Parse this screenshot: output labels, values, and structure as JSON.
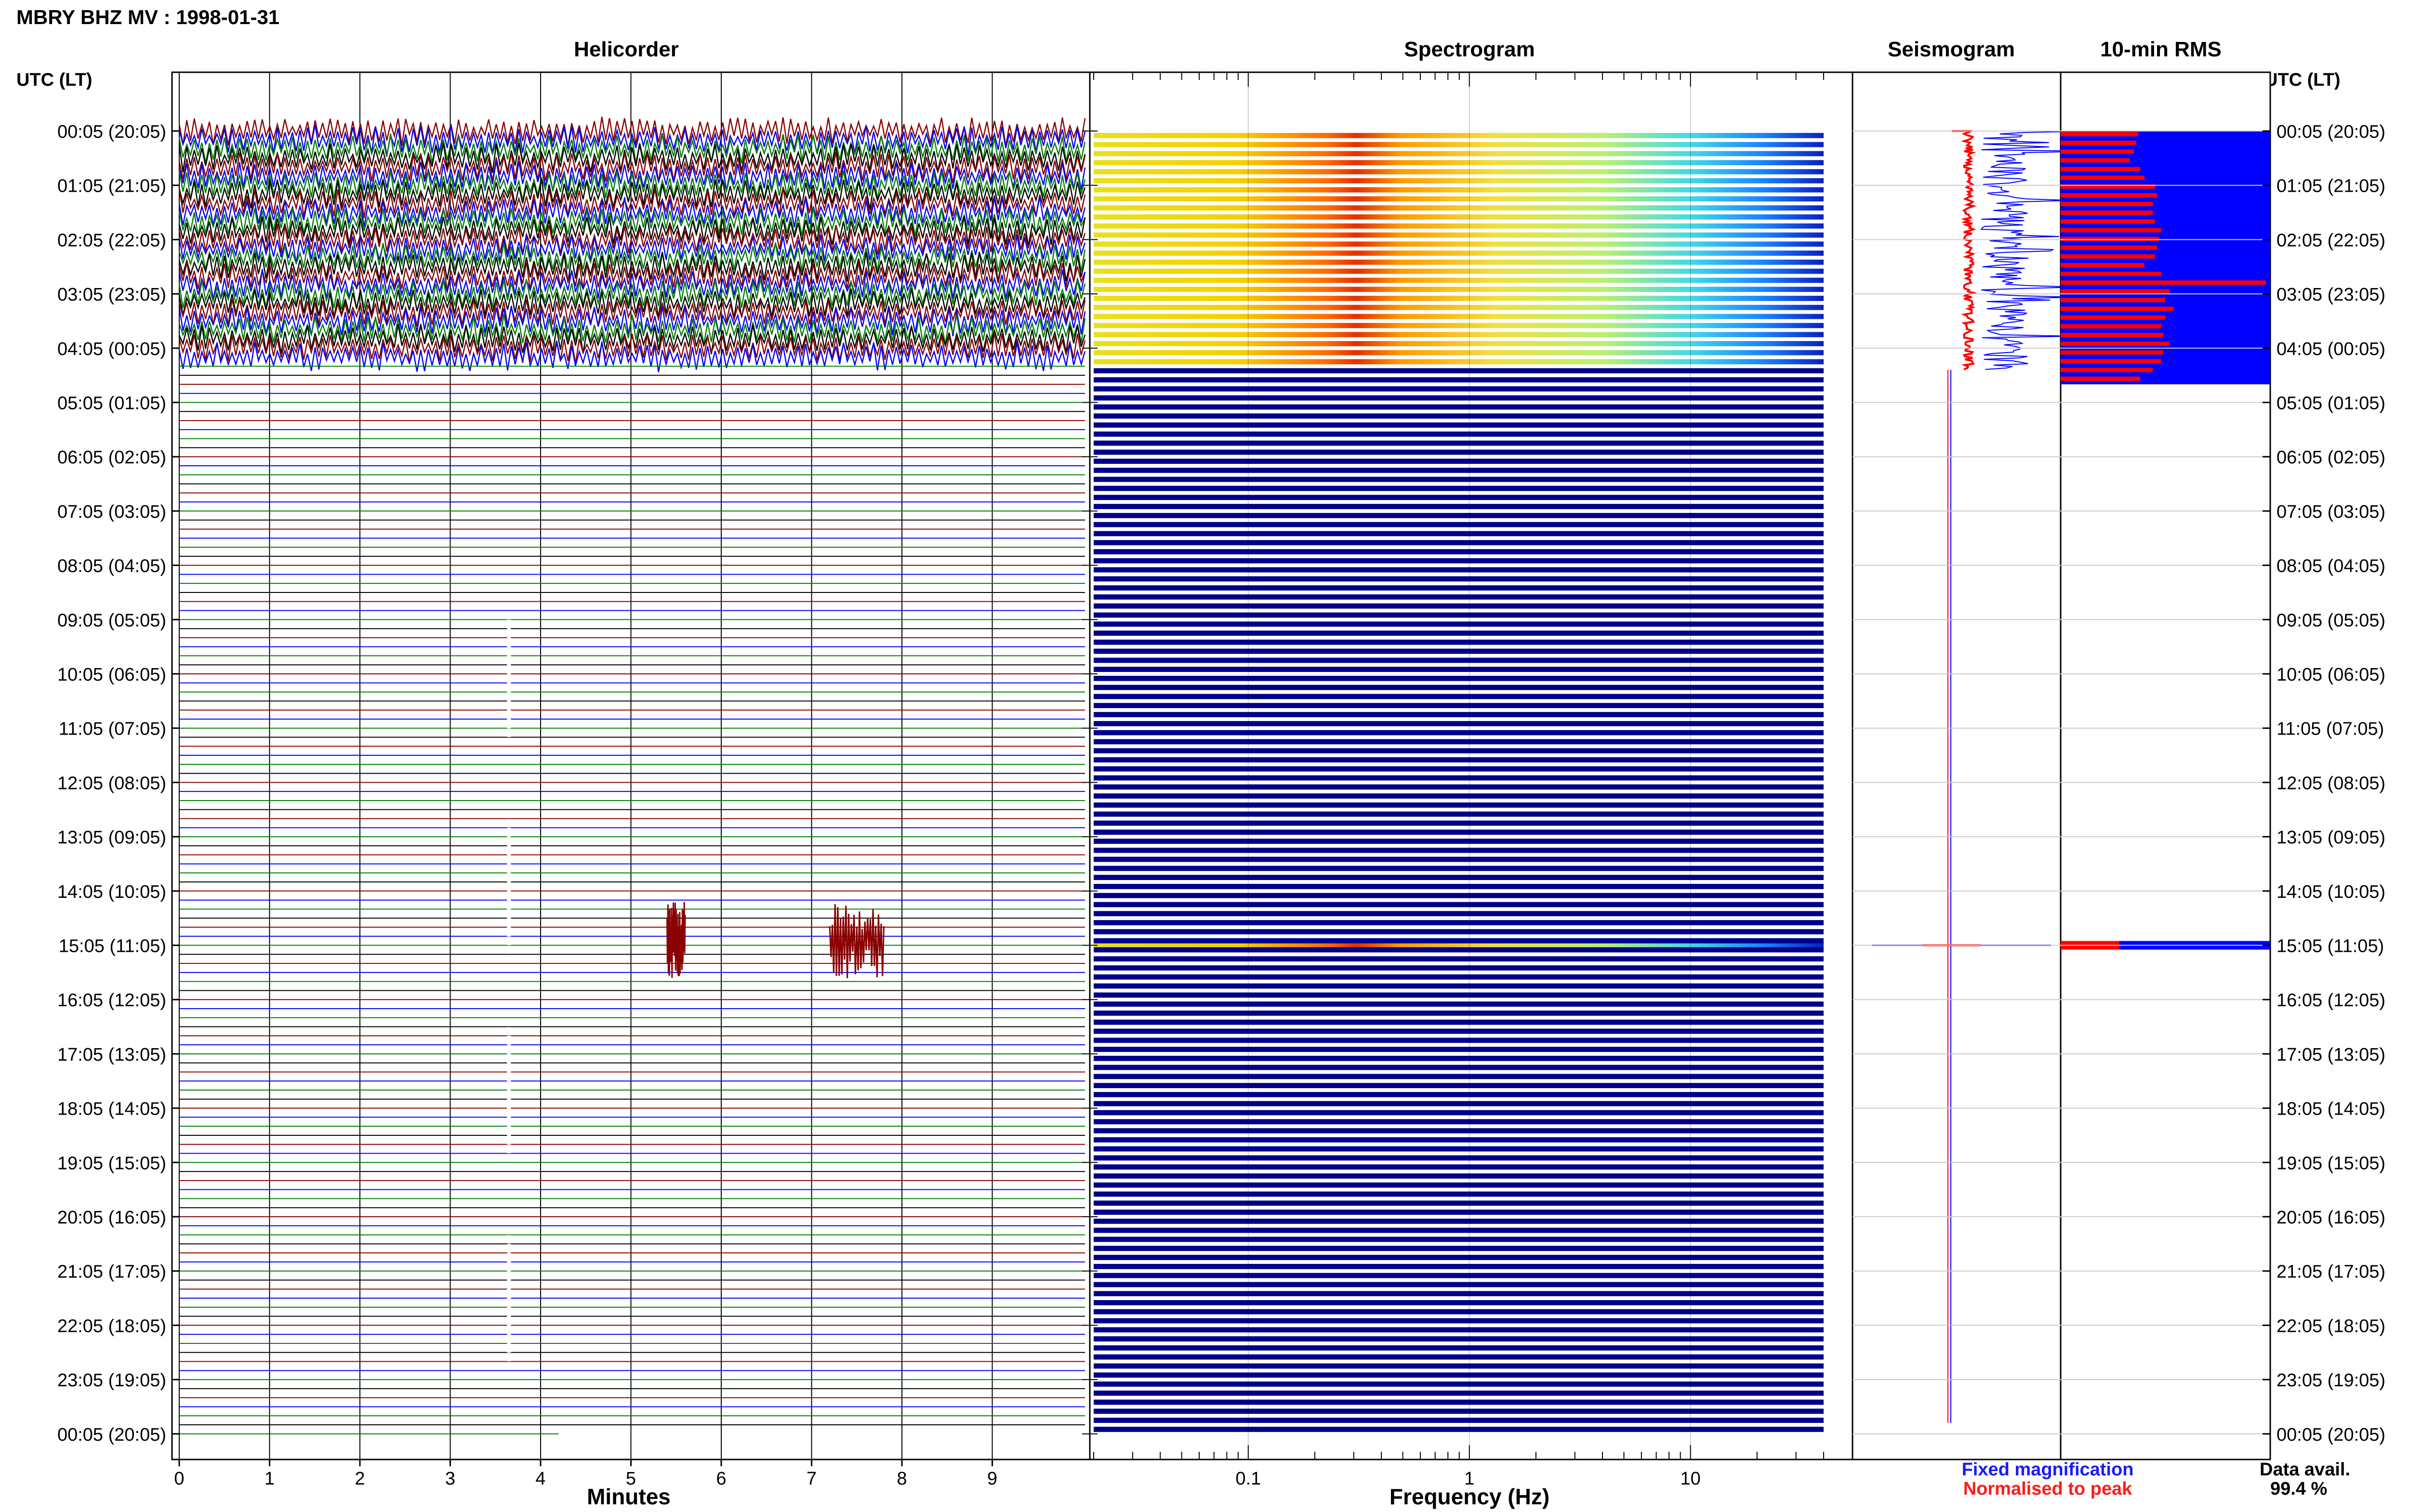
{
  "title": "MBRY BHZ MV : 1998-01-31",
  "time_axis_label": "UTC (LT)",
  "panels": {
    "helicorder": "Helicorder",
    "spectrogram": "Spectrogram",
    "seismogram": "Seismogram",
    "rms": "10-min RMS"
  },
  "xlabels": {
    "helicorder": "Minutes",
    "spectrogram": "Frequency (Hz)"
  },
  "legend": {
    "fixed": "Fixed magnification",
    "normalised": "Normalised to peak"
  },
  "data_availability": {
    "label": "Data avail.",
    "value": "99.4 %"
  },
  "colors": {
    "helicorder_traces": [
      "#8b0000",
      "#0000ff",
      "#008000",
      "#000000"
    ],
    "fixed": "#0000ff",
    "normalised": "#ff0000",
    "spectrogram_background": "#00008b"
  },
  "chart_data": {
    "type": "helicorder",
    "time_labels": [
      "00:05 (20:05)",
      "01:05 (21:05)",
      "02:05 (22:05)",
      "03:05 (23:05)",
      "04:05 (00:05)",
      "05:05 (01:05)",
      "06:05 (02:05)",
      "07:05 (03:05)",
      "08:05 (04:05)",
      "09:05 (05:05)",
      "10:05 (06:05)",
      "11:05 (07:05)",
      "12:05 (08:05)",
      "13:05 (09:05)",
      "14:05 (10:05)",
      "15:05 (11:05)",
      "16:05 (12:05)",
      "17:05 (13:05)",
      "18:05 (14:05)",
      "19:05 (15:05)",
      "20:05 (16:05)",
      "21:05 (17:05)",
      "22:05 (18:05)",
      "23:05 (19:05)",
      "00:05 (20:05)"
    ],
    "minutes_ticks": [
      0,
      1,
      2,
      3,
      4,
      5,
      6,
      7,
      8,
      9
    ],
    "minutes_range": [
      0,
      10
    ],
    "frequency_ticks": [
      0.1,
      1,
      10
    ],
    "frequency_range": [
      0.02,
      40
    ],
    "frequency_scale": "log",
    "rows_per_hour": 6,
    "active_hours": [
      0,
      4.4
    ],
    "event_hour": 15,
    "helicorder_events": [
      {
        "hour": 14.9,
        "minute_start": 5.4,
        "minute_end": 5.6
      },
      {
        "hour": 14.9,
        "minute_start": 7.2,
        "minute_end": 7.8
      }
    ],
    "rms_fixed_fraction": [
      0.37,
      0.36,
      0.35,
      0.33,
      0.38,
      0.4,
      0.45,
      0.46,
      0.44,
      0.44,
      0.45,
      0.48,
      0.47,
      0.46,
      0.45,
      0.4,
      0.48,
      0.98,
      0.52,
      0.5,
      0.54,
      0.5,
      0.48,
      0.49,
      0.52,
      0.49,
      0.48,
      0.44,
      0.38
    ],
    "rms_event_fraction": 0.28
  }
}
